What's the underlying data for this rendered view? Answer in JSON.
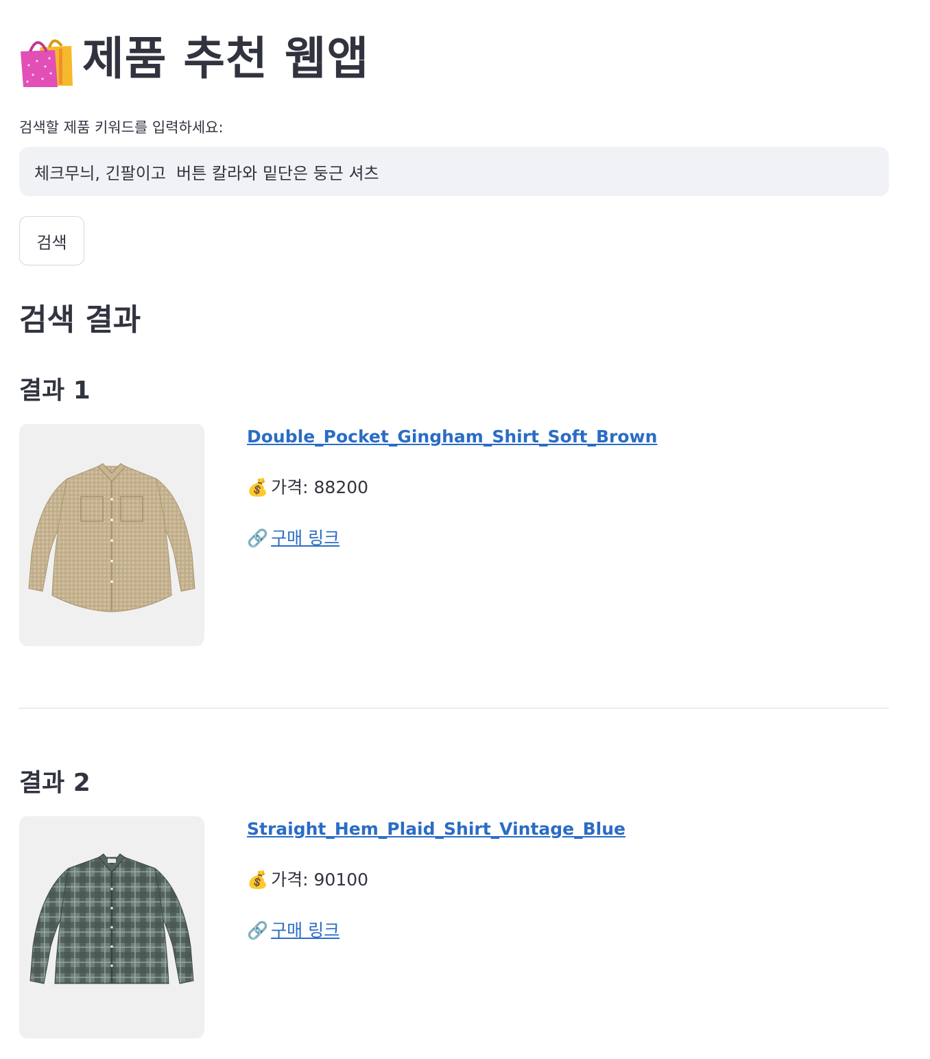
{
  "header": {
    "title": "제품 추천 웹앱",
    "icon": "shopping-bags-icon"
  },
  "search": {
    "label": "검색할 제품 키워드를 입력하세요:",
    "value": "체크무늬, 긴팔이고  버튼 칼라와 밑단은 둥근 셔츠",
    "button_label": "검색"
  },
  "results": {
    "heading": "검색 결과",
    "items": [
      {
        "title": "결과 1",
        "name": "Double_Pocket_Gingham_Shirt_Soft_Brown",
        "price_icon": "💰",
        "price_label": "가격: 88200",
        "link_icon": "🔗",
        "link_label": "구매 링크",
        "image": "beige-gingham-shirt",
        "shirt_color": "#c8b596"
      },
      {
        "title": "결과 2",
        "name": "Straight_Hem_Plaid_Shirt_Vintage_Blue",
        "price_icon": "💰",
        "price_label": "가격: 90100",
        "link_icon": "🔗",
        "link_label": "구매 링크",
        "image": "blue-plaid-shirt",
        "shirt_color": "#5b6d68"
      }
    ]
  },
  "colors": {
    "text": "#31333f",
    "link": "#2b6cc4",
    "input_bg": "#f0f2f6",
    "image_bg": "#f0f0f0"
  }
}
